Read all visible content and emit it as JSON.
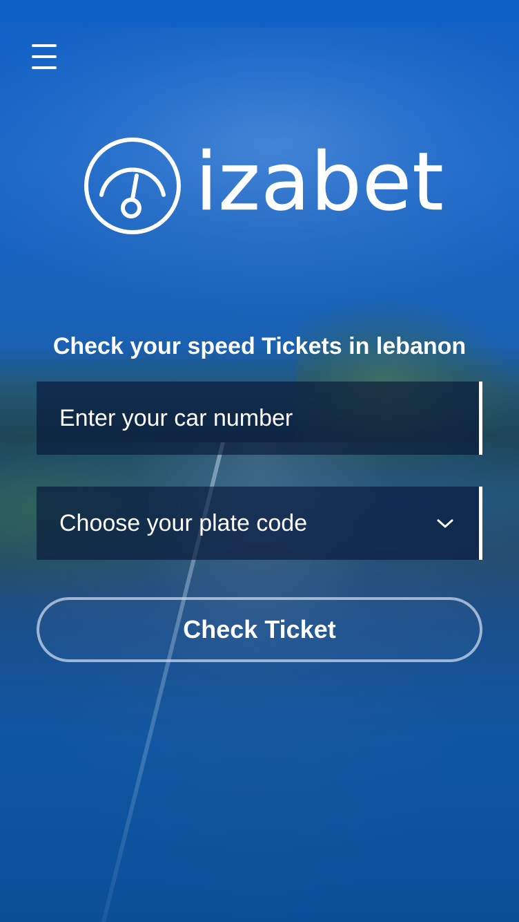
{
  "header": {
    "menu_icon": "hamburger-menu-icon"
  },
  "logo": {
    "text": "izabet",
    "icon": "speedometer-icon"
  },
  "main": {
    "tagline": "Check your speed Tickets in lebanon",
    "car_number": {
      "placeholder": "Enter your car number",
      "value": ""
    },
    "plate_code": {
      "placeholder": "Choose your plate code",
      "icon": "chevron-down-icon"
    },
    "check_button_label": "Check Ticket"
  },
  "colors": {
    "background_top": "#0e5fc4",
    "background_bottom": "#0b4f99",
    "field_background": "#051437",
    "text": "#ffffff"
  }
}
